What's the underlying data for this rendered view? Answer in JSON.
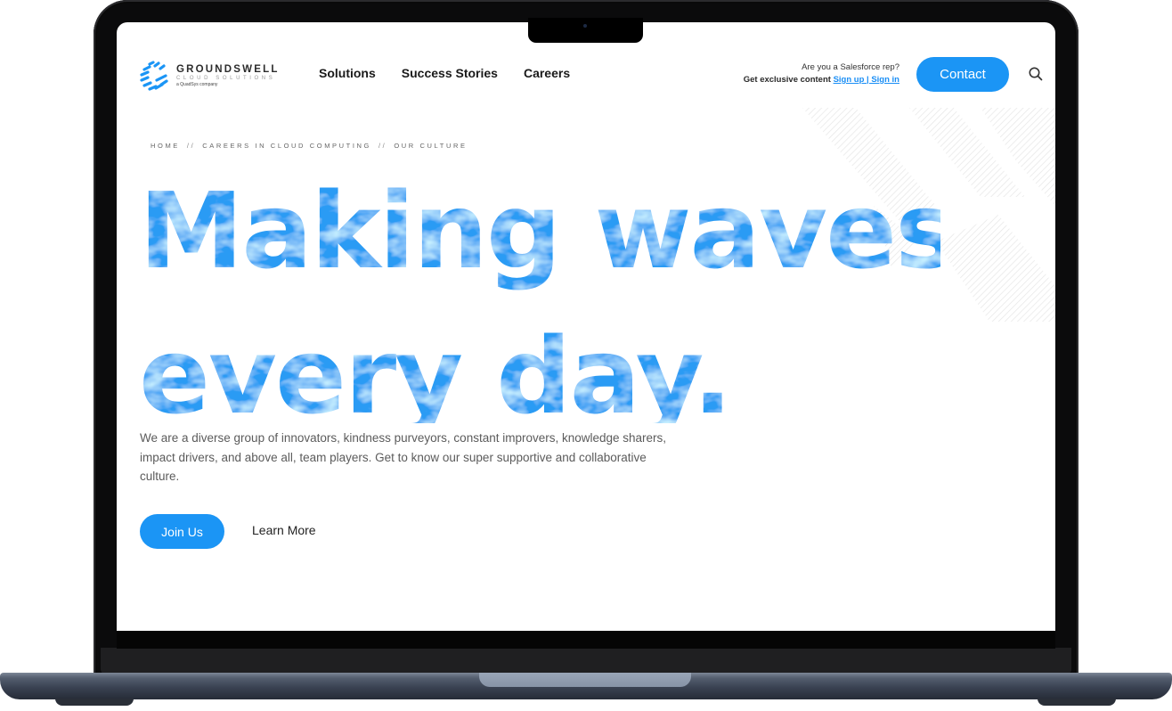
{
  "brand": {
    "name": "GROUNDSWELL",
    "subtitle": "CLOUD SOLUTIONS",
    "tagline": "a QuadSys company",
    "accent_color": "#1b95f5"
  },
  "nav": {
    "items": [
      {
        "label": "Solutions"
      },
      {
        "label": "Success Stories"
      },
      {
        "label": "Careers"
      }
    ]
  },
  "header_promo": {
    "line1": "Are you a Salesforce rep?",
    "line2_prefix": "Get exclusive content",
    "line2_links": "Sign up | Sign in"
  },
  "header_actions": {
    "contact_label": "Contact",
    "search_icon": "search-icon"
  },
  "breadcrumb": {
    "items": [
      "HOME",
      "CAREERS IN CLOUD COMPUTING",
      "OUR CULTURE"
    ],
    "separator": "//"
  },
  "hero": {
    "line1": "Making waves",
    "line2": "every day.",
    "description": "We are a diverse group of innovators, kindness purveyors, constant improvers, knowledge sharers, impact drivers, and above all, team players. Get to know our super supportive and collaborative culture.",
    "primary_cta": "Join Us",
    "secondary_cta": "Learn More"
  }
}
